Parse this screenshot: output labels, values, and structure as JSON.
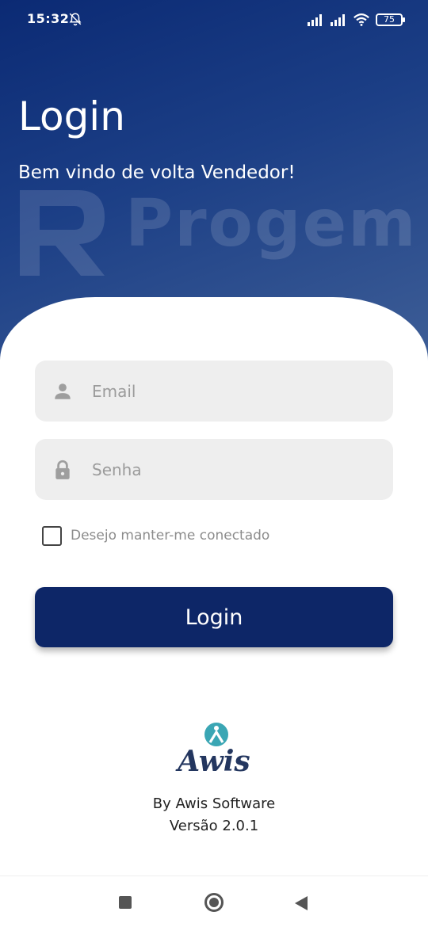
{
  "status_bar": {
    "time": "15:32",
    "battery": "75"
  },
  "header": {
    "title": "Login",
    "subtitle": "Bem vindo de volta Vendedor!",
    "watermark_text": "Progem"
  },
  "form": {
    "email_placeholder": "Email",
    "password_placeholder": "Senha",
    "remember_label": "Desejo manter-me conectado",
    "remember_checked": false,
    "login_button": "Login"
  },
  "footer": {
    "brand": "Awis",
    "by_line": "By Awis Software",
    "version": "Versão 2.0.1"
  },
  "colors": {
    "primary": "#0d2667",
    "header_gradient_start": "#0b2a74",
    "header_gradient_end": "#3f5f97",
    "field_bg": "#eeeeee",
    "brand_teal": "#3aa6b4",
    "brand_navy": "#23365f"
  },
  "icons": {
    "mute": "bell-off-icon",
    "signal": "signal-icon",
    "wifi": "wifi-icon",
    "battery": "battery-icon",
    "email_field": "person-icon",
    "password_field": "lock-icon",
    "nav_recents": "square-icon",
    "nav_home": "circle-icon",
    "nav_back": "triangle-back-icon"
  }
}
